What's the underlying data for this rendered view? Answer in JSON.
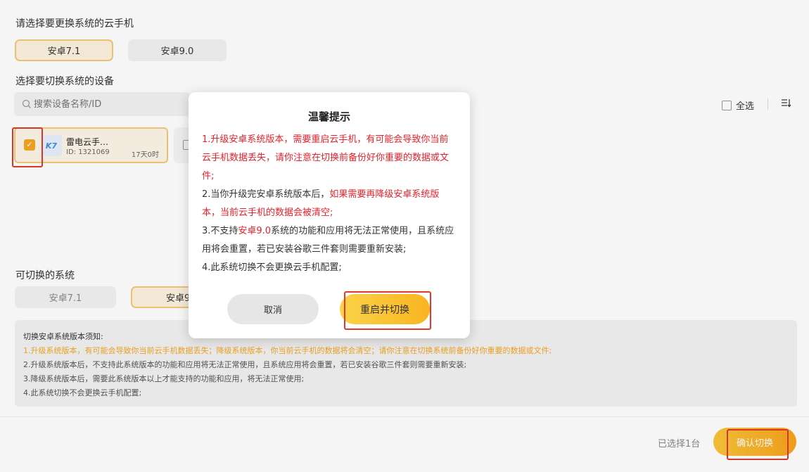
{
  "header": {
    "select_phone_label": "请选择要更换系统的云手机",
    "select_device_label": "选择要切换系统的设备",
    "switchable_label": "可切换的系统"
  },
  "current_system_options": [
    {
      "label": "安卓7.1",
      "selected": true
    },
    {
      "label": "安卓9.0",
      "selected": false
    }
  ],
  "search": {
    "placeholder": "搜索设备名称/ID",
    "icon": "search-icon"
  },
  "select_all": {
    "label": "全选",
    "checked": false
  },
  "sort_icon": "sort-icon",
  "devices": [
    {
      "name": "雷电云手…",
      "id": "ID: 1321069",
      "time": "17天0时",
      "checked": true,
      "thumb_text": "K7"
    }
  ],
  "switchable_options": [
    {
      "label": "安卓7.1",
      "selected": false
    },
    {
      "label": "安卓9",
      "selected": true
    }
  ],
  "notice": {
    "title": "切换安卓系统版本须知:",
    "lines": [
      "1.升级系统版本，有可能会导致你当前云手机数据丢失；降级系统版本，你当前云手机的数据将会清空；请你注意在切换系统前备份好你重要的数据或文件;",
      "2.升级系统版本后，不支持此系统版本的功能和应用将无法正常使用，且系统应用将会重置，若已安装谷歌三件套则需要重新安装;",
      "3.降级系统版本后，需要此系统版本以上才能支持的功能和应用，将无法正常使用;",
      "4.此系统切换不会更换云手机配置;"
    ]
  },
  "footer": {
    "selected_count": "已选择1台",
    "confirm_label": "确认切换"
  },
  "modal": {
    "title": "温馨提示",
    "item1": "1.升级安卓系统版本，需要重启云手机，有可能会导致你当前云手机数据丢失，请你注意在切换前备份好你重要的数据或文件;",
    "item2_prefix": "2.当你升级完安卓系统版本后，",
    "item2_red": "如果需要再降级安卓系统版本，当前云手机的数据会被清空;",
    "item3_prefix": "3.不支持",
    "item3_red": "安卓9.0",
    "item3_suffix": "系统的功能和应用将无法正常使用，且系统应用将会重置，若已安装谷歌三件套则需要重新安装;",
    "item4": "4.此系统切换不会更换云手机配置;",
    "cancel_label": "取消",
    "ok_label": "重启并切换"
  },
  "colors": {
    "accent": "#f5a623",
    "warning_red": "#e8212a",
    "highlight_box": "#e03a2a"
  }
}
